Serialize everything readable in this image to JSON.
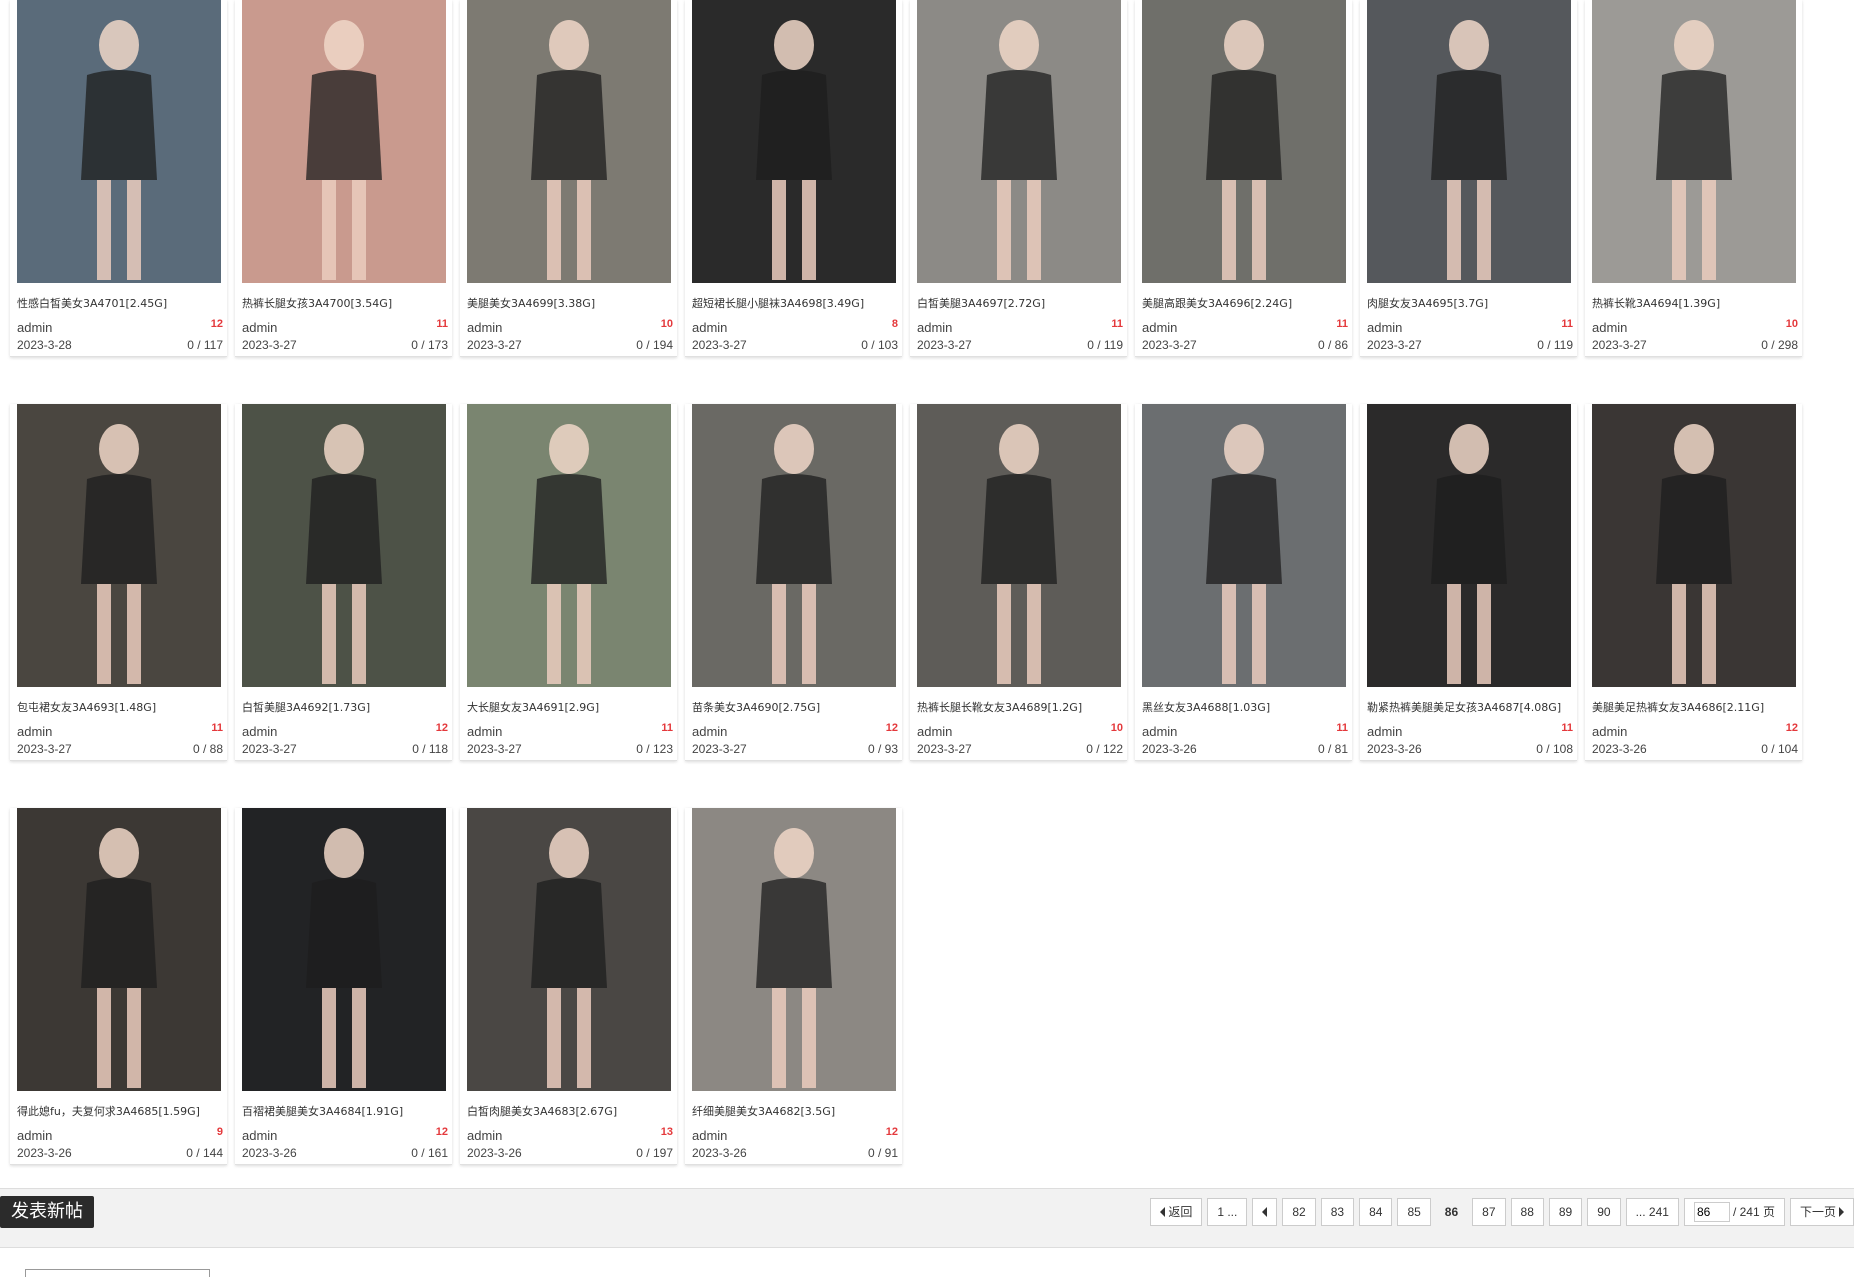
{
  "posts": [
    {
      "title": "性感白皙美女3A4701[2.45G]",
      "author": "admin",
      "replies": "12",
      "date": "2023-3-28",
      "views": "0 / 117",
      "bg": "#5a6b7a"
    },
    {
      "title": "热裤长腿女孩3A4700[3.54G]",
      "author": "admin",
      "replies": "11",
      "date": "2023-3-27",
      "views": "0 / 173",
      "bg": "#c99a8e"
    },
    {
      "title": "美腿美女3A4699[3.38G]",
      "author": "admin",
      "replies": "10",
      "date": "2023-3-27",
      "views": "0 / 194",
      "bg": "#7d7a72"
    },
    {
      "title": "超短裙长腿小腿袜3A4698[3.49G]",
      "author": "admin",
      "replies": "8",
      "date": "2023-3-27",
      "views": "0 / 103",
      "bg": "#2a2a2a"
    },
    {
      "title": "白皙美腿3A4697[2.72G]",
      "author": "admin",
      "replies": "11",
      "date": "2023-3-27",
      "views": "0 / 119",
      "bg": "#8c8a86"
    },
    {
      "title": "美腿高跟美女3A4696[2.24G]",
      "author": "admin",
      "replies": "11",
      "date": "2023-3-27",
      "views": "0 / 86",
      "bg": "#6f6f6a"
    },
    {
      "title": "肉腿女友3A4695[3.7G]",
      "author": "admin",
      "replies": "11",
      "date": "2023-3-27",
      "views": "0 / 119",
      "bg": "#55585c"
    },
    {
      "title": "热裤长靴3A4694[1.39G]",
      "author": "admin",
      "replies": "10",
      "date": "2023-3-27",
      "views": "0 / 298",
      "bg": "#9c9a96"
    },
    {
      "title": "包屯裙女友3A4693[1.48G]",
      "author": "admin",
      "replies": "11",
      "date": "2023-3-27",
      "views": "0 / 88",
      "bg": "#4a4640"
    },
    {
      "title": "白皙美腿3A4692[1.73G]",
      "author": "admin",
      "replies": "12",
      "date": "2023-3-27",
      "views": "0 / 118",
      "bg": "#4d5247"
    },
    {
      "title": "大长腿女友3A4691[2.9G]",
      "author": "admin",
      "replies": "11",
      "date": "2023-3-27",
      "views": "0 / 123",
      "bg": "#7a8570"
    },
    {
      "title": "苗条美女3A4690[2.75G]",
      "author": "admin",
      "replies": "12",
      "date": "2023-3-27",
      "views": "0 / 93",
      "bg": "#6a6964"
    },
    {
      "title": "热裤长腿长靴女友3A4689[1.2G]",
      "author": "admin",
      "replies": "10",
      "date": "2023-3-27",
      "views": "0 / 122",
      "bg": "#5e5c58"
    },
    {
      "title": "黑丝女友3A4688[1.03G]",
      "author": "admin",
      "replies": "11",
      "date": "2023-3-26",
      "views": "0 / 81",
      "bg": "#6b6e70"
    },
    {
      "title": "勒紧热裤美腿美足女孩3A4687[4.08G]",
      "author": "admin",
      "replies": "11",
      "date": "2023-3-26",
      "views": "0 / 108",
      "bg": "#2b2a2a"
    },
    {
      "title": "美腿美足热裤女友3A4686[2.11G]",
      "author": "admin",
      "replies": "12",
      "date": "2023-3-26",
      "views": "0 / 104",
      "bg": "#3a3634"
    },
    {
      "title": "得此媳fu，夫复何求3A4685[1.59G]",
      "author": "admin",
      "replies": "9",
      "date": "2023-3-26",
      "views": "0 / 144",
      "bg": "#3c3834"
    },
    {
      "title": "百褶裙美腿美女3A4684[1.91G]",
      "author": "admin",
      "replies": "12",
      "date": "2023-3-26",
      "views": "0 / 161",
      "bg": "#222325"
    },
    {
      "title": "白皙肉腿美女3A4683[2.67G]",
      "author": "admin",
      "replies": "13",
      "date": "2023-3-26",
      "views": "0 / 197",
      "bg": "#4a4744"
    },
    {
      "title": "纤细美腿美女3A4682[3.5G]",
      "author": "admin",
      "replies": "12",
      "date": "2023-3-26",
      "views": "0 / 91",
      "bg": "#8c8883"
    }
  ],
  "post_button": "发表新帖",
  "pager": {
    "back": "返回",
    "first": "1 ...",
    "pages": [
      "82",
      "83",
      "84",
      "85",
      "86",
      "87",
      "88",
      "89",
      "90"
    ],
    "current": "86",
    "last": "... 241",
    "input_value": "86",
    "total": "/ 241 页",
    "next": "下一页"
  },
  "colors": {
    "reply_red": "#e4393c",
    "post_button_bg": "#2b2b2b"
  }
}
